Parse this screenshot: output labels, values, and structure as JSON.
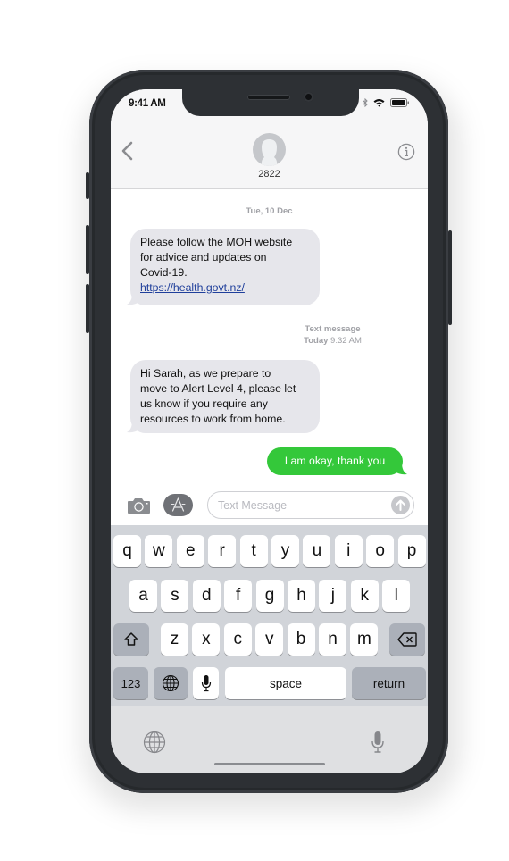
{
  "status_bar": {
    "time": "9:41 AM",
    "icons": [
      "bluetooth-icon",
      "wifi-icon",
      "battery-icon"
    ]
  },
  "conversation_header": {
    "back_icon": "chevron-left-icon",
    "avatar_icon": "person-silhouette-icon",
    "contact_name": "2822",
    "info_icon": "info-circle-icon"
  },
  "messages": {
    "date_header": "Tue, 10 Dec",
    "first_message": {
      "direction": "incoming",
      "lines": [
        "Please follow the MOH website",
        "for advice and updates on",
        "Covid-19."
      ],
      "link": "https://health.govt.nz/"
    },
    "second_header": {
      "type_label": "Text message",
      "day": "Today",
      "time": "9:32 AM"
    },
    "second_message": {
      "direction": "incoming",
      "lines": [
        "Hi Sarah, as we prepare to",
        "move to Alert Level 4, please let",
        "us know if you require any",
        "resources to work from home."
      ]
    },
    "reply": {
      "direction": "outgoing",
      "text": "I am okay, thank you"
    }
  },
  "input_bar": {
    "camera_icon": "camera-icon",
    "appstore_icon": "app-store-icon",
    "placeholder": "Text Message",
    "send_icon": "arrow-up-icon"
  },
  "keyboard": {
    "row1": [
      "q",
      "w",
      "e",
      "r",
      "t",
      "y",
      "u",
      "i",
      "o",
      "p"
    ],
    "row2": [
      "a",
      "s",
      "d",
      "f",
      "g",
      "h",
      "j",
      "k",
      "l"
    ],
    "row3": [
      "z",
      "x",
      "c",
      "v",
      "b",
      "n",
      "m"
    ],
    "shift_icon": "shift-arrow-icon",
    "delete_icon": "backspace-icon",
    "numbers_label": "123",
    "globe_icon": "globe-icon",
    "mic_icon": "microphone-icon",
    "space_label": "space",
    "return_label": "return"
  },
  "bottom_bar": {
    "globe_icon": "globe-icon",
    "dictation_icon": "microphone-icon"
  },
  "colors": {
    "incoming_bubble": "#e6e6eb",
    "outgoing_bubble": "#34c83a",
    "link": "#1f3f9b",
    "phone_frame": "#2d3034",
    "keyboard_bg": "#d1d4d9"
  }
}
